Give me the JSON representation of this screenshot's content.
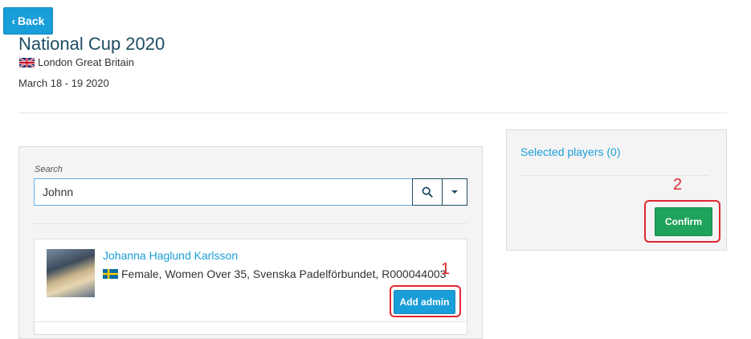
{
  "header": {
    "back_label": "Back",
    "title": "National Cup 2020",
    "location": "London Great Britain",
    "dates": "March 18 - 19 2020"
  },
  "search": {
    "label": "Search",
    "value": "Johnn"
  },
  "results": [
    {
      "name": "Johanna Haglund Karlsson",
      "info": "Female, Women Over 35, Svenska Padelförbundet, R000044003",
      "action_label": "Add admin"
    }
  ],
  "selected": {
    "title": "Selected players (0)",
    "confirm_label": "Confirm"
  },
  "annotations": [
    "1",
    "2"
  ],
  "colors": {
    "primary": "#1a9ed9",
    "title": "#1e4c63",
    "confirm": "#1fa35b",
    "annotation": "#e0262f"
  }
}
